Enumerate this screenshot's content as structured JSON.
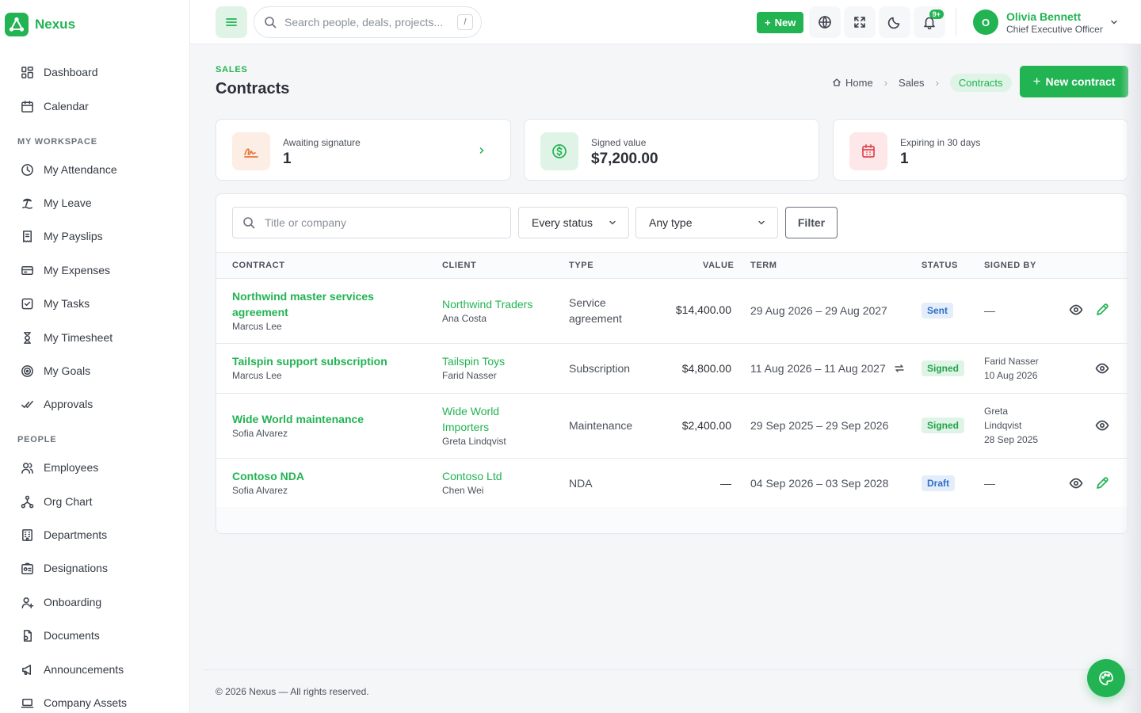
{
  "brand": {
    "name": "Nexus"
  },
  "sidebar": {
    "top_items": [
      {
        "label": "Dashboard",
        "icon": "dashboard-icon"
      },
      {
        "label": "Calendar",
        "icon": "calendar-icon"
      }
    ],
    "section_workspace": "MY WORKSPACE",
    "workspace_items": [
      {
        "label": "My Attendance",
        "icon": "clock-icon"
      },
      {
        "label": "My Leave",
        "icon": "beach-icon"
      },
      {
        "label": "My Payslips",
        "icon": "receipt-icon"
      },
      {
        "label": "My Expenses",
        "icon": "credit-card-icon"
      },
      {
        "label": "My Tasks",
        "icon": "checkbox-icon"
      },
      {
        "label": "My Timesheet",
        "icon": "hourglass-icon"
      },
      {
        "label": "My Goals",
        "icon": "target-icon"
      },
      {
        "label": "Approvals",
        "icon": "double-check-icon"
      }
    ],
    "section_people": "PEOPLE",
    "people_items": [
      {
        "label": "Employees",
        "icon": "users-icon"
      },
      {
        "label": "Org Chart",
        "icon": "hierarchy-icon"
      },
      {
        "label": "Departments",
        "icon": "building-icon"
      },
      {
        "label": "Designations",
        "icon": "id-badge-icon"
      },
      {
        "label": "Onboarding",
        "icon": "user-plus-icon"
      },
      {
        "label": "Documents",
        "icon": "document-icon"
      },
      {
        "label": "Announcements",
        "icon": "megaphone-icon"
      },
      {
        "label": "Company Assets",
        "icon": "laptop-icon"
      }
    ]
  },
  "topbar": {
    "search_placeholder": "Search people, deals, projects...",
    "search_shortcut": "/",
    "new_label": "New",
    "notif_count": "9+",
    "user": {
      "initial": "O",
      "name": "Olivia Bennett",
      "role": "Chief Executive Officer"
    }
  },
  "page": {
    "eyebrow": "SALES",
    "title": "Contracts",
    "breadcrumb": {
      "home": "Home",
      "sales": "Sales",
      "current": "Contracts"
    },
    "new_contract_label": "New contract"
  },
  "stats": [
    {
      "label": "Awaiting signature",
      "value": "1",
      "color": "#e8743b",
      "bg": "#fdeee5"
    },
    {
      "label": "Signed value",
      "value": "$7,200.00",
      "color": "#22b352",
      "bg": "#dff4e6"
    },
    {
      "label": "Expiring in 30 days",
      "value": "1",
      "color": "#e0454f",
      "bg": "#fde7e8"
    }
  ],
  "filters": {
    "search_placeholder": "Title or company",
    "status_value": "Every status",
    "type_value": "Any type",
    "filter_label": "Filter"
  },
  "table": {
    "headers": {
      "contract": "CONTRACT",
      "client": "CLIENT",
      "type": "TYPE",
      "value": "VALUE",
      "term": "TERM",
      "status": "STATUS",
      "signed_by": "SIGNED BY"
    },
    "rows": [
      {
        "title_l1": "Northwind master services",
        "title_l2": "agreement",
        "owner": "Marcus Lee",
        "client_l1": "Northwind Traders",
        "client_l2": "",
        "contact": "Ana Costa",
        "type_l1": "Service",
        "type_l2": "agreement",
        "value": "$14,400.00",
        "term": "29 Aug 2026 – 29 Aug 2027",
        "status": "Sent",
        "signed_l1": "—",
        "signed_l2": "",
        "signed_l3": ""
      },
      {
        "title_l1": "Tailspin support subscription",
        "title_l2": "",
        "owner": "Marcus Lee",
        "client_l1": "Tailspin Toys",
        "client_l2": "",
        "contact": "Farid Nasser",
        "type_l1": "Subscription",
        "type_l2": "",
        "value": "$4,800.00",
        "term": "11 Aug 2026 – 11 Aug 2027",
        "status": "Signed",
        "signed_l1": "Farid Nasser",
        "signed_l2": "10 Aug 2026",
        "signed_l3": ""
      },
      {
        "title_l1": "Wide World maintenance",
        "title_l2": "",
        "owner": "Sofia Alvarez",
        "client_l1": "Wide World",
        "client_l2": "Importers",
        "contact": "Greta Lindqvist",
        "type_l1": "Maintenance",
        "type_l2": "",
        "value": "$2,400.00",
        "term": "29 Sep 2025 – 29 Sep 2026",
        "status": "Signed",
        "signed_l1": "Greta",
        "signed_l2": "Lindqvist",
        "signed_l3": "28 Sep 2025"
      },
      {
        "title_l1": "Contoso NDA",
        "title_l2": "",
        "owner": "Sofia Alvarez",
        "client_l1": "Contoso Ltd",
        "client_l2": "",
        "contact": "Chen Wei",
        "type_l1": "NDA",
        "type_l2": "",
        "value": "—",
        "term": "04 Sep 2026 – 03 Sep 2028",
        "status": "Draft",
        "signed_l1": "—",
        "signed_l2": "",
        "signed_l3": ""
      }
    ]
  },
  "footer": {
    "text": "© 2026 Nexus — All rights reserved."
  },
  "colors": {
    "accent": "#22b352",
    "sent": "#2f6fc7",
    "draft": "#2f6fc7"
  }
}
